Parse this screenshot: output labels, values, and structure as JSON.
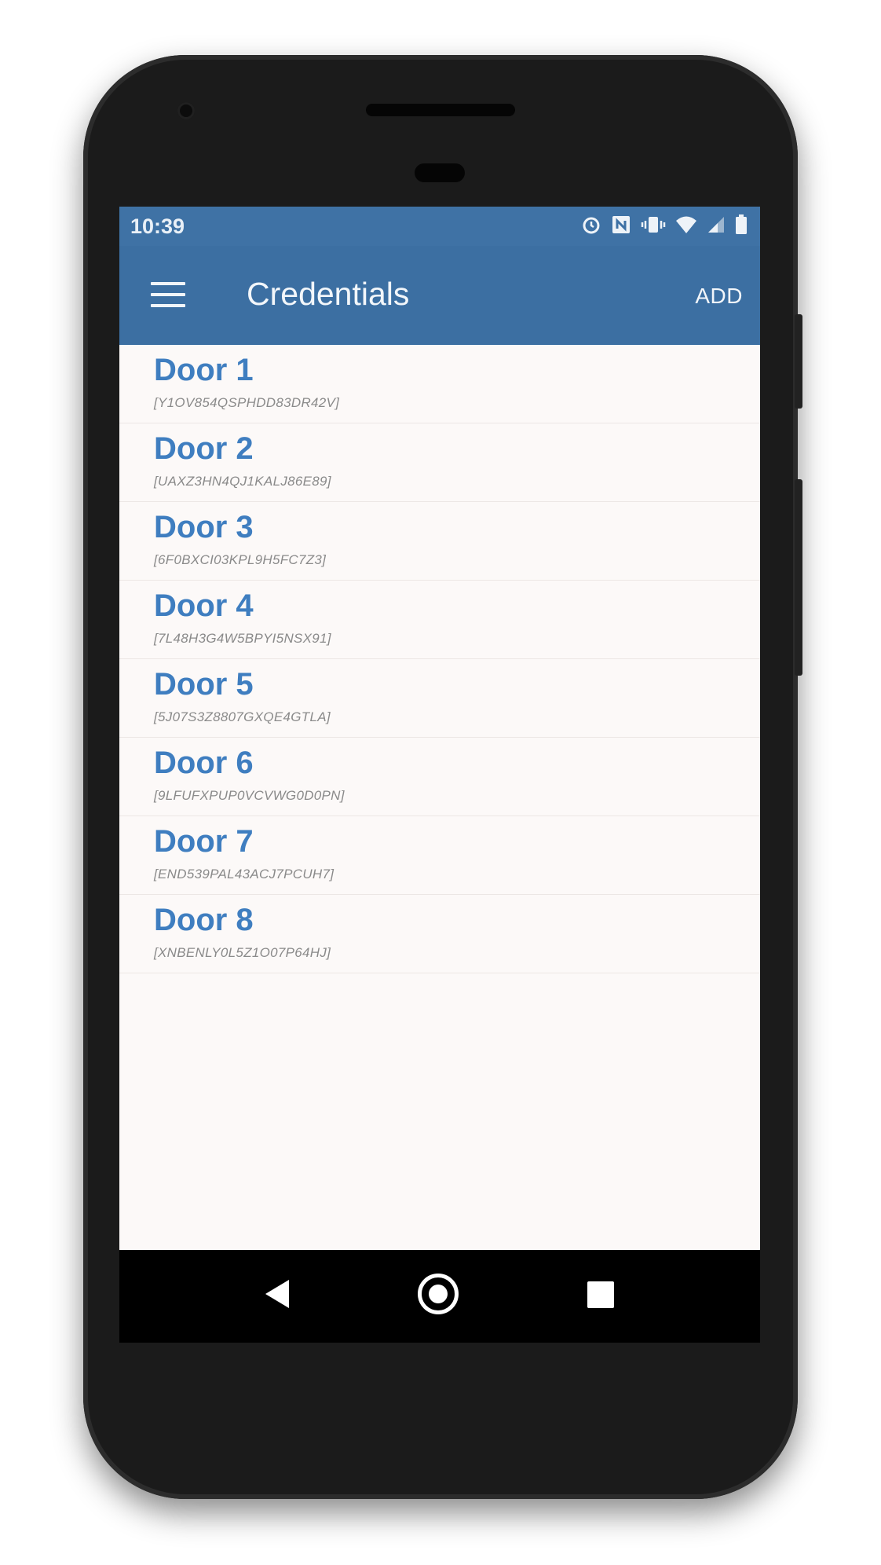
{
  "status_bar": {
    "time": "10:39",
    "icons": [
      "alarm-icon",
      "nfc-icon",
      "vibrate-icon",
      "wifi-icon",
      "signal-icon",
      "battery-icon"
    ]
  },
  "toolbar": {
    "title": "Credentials",
    "add_label": "ADD",
    "menu_icon": "hamburger-menu-icon",
    "color": "#3c6fa2"
  },
  "credentials": [
    {
      "name": "Door 1",
      "id": "[Y1OV854QSPHDD83DR42V]"
    },
    {
      "name": "Door 2",
      "id": "[UAXZ3HN4QJ1KALJ86E89]"
    },
    {
      "name": "Door 3",
      "id": "[6F0BXCI03KPL9H5FC7Z3]"
    },
    {
      "name": "Door 4",
      "id": "[7L48H3G4W5BPYI5NSX91]"
    },
    {
      "name": "Door 5",
      "id": "[5J07S3Z8807GXQE4GTLA]"
    },
    {
      "name": "Door 6",
      "id": "[9LFUFXPUP0VCVWG0D0PN]"
    },
    {
      "name": "Door 7",
      "id": "[END539PAL43ACJ7PCUH7]"
    },
    {
      "name": "Door 8",
      "id": "[XNBENLY0L5Z1O07P64HJ]"
    }
  ],
  "nav_bar": {
    "back_icon": "back-triangle-icon",
    "home_icon": "home-circle-icon",
    "recent_icon": "recent-apps-square-icon"
  },
  "colors": {
    "accent": "#3c6fa2",
    "item_title": "#3f7ec0",
    "background": "#fcf9f8"
  }
}
